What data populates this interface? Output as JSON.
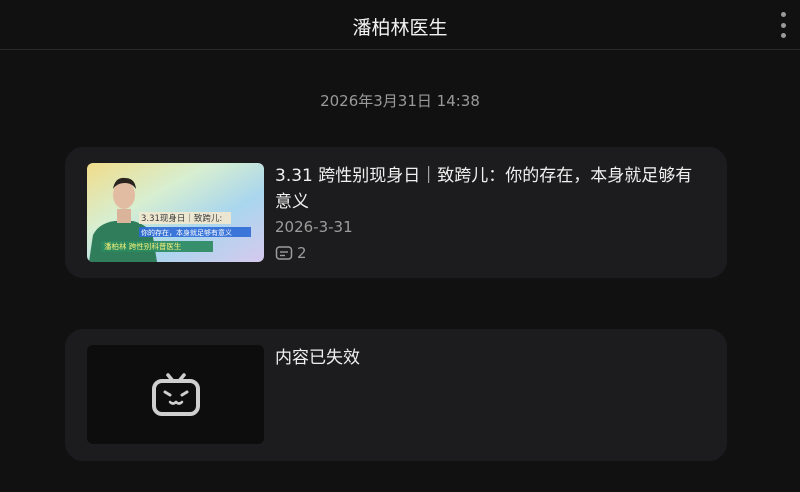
{
  "header": {
    "title": "潘柏林医生",
    "more_icon": "more-vertical-icon"
  },
  "message": {
    "timestamp": "2026年3月31日 14:38"
  },
  "cards": [
    {
      "title": "3.31 跨性别现身日｜致跨儿：你的存在，本身就足够有意义",
      "date": "2026-3-31",
      "comment_count": "2",
      "comment_icon": "comment-icon",
      "thumbnail": {
        "line1": "3.31现身日｜致跨儿:",
        "line2": "你的存在，本身就足够有意义",
        "line3": "潘柏林 跨性别科普医生"
      }
    },
    {
      "title": "内容已失效",
      "placeholder_icon": "bilibili-tv-icon"
    }
  ],
  "colors": {
    "background": "#111111",
    "card": "#1c1c1e",
    "text_primary": "#f0f0f0",
    "text_secondary": "#9c9c9c"
  }
}
